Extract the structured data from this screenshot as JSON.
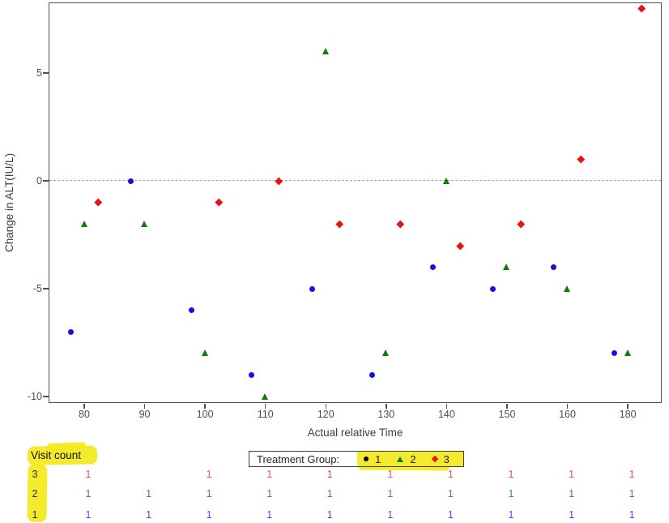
{
  "chart_data": {
    "type": "scatter",
    "title": "",
    "xlabel": "Actual relative Time",
    "ylabel": "Change in ALT(IU/L)",
    "categories": [
      80,
      90,
      100,
      110,
      120,
      130,
      140,
      150,
      160,
      180
    ],
    "x_ticks": [
      "80",
      "90",
      "100",
      "110",
      "120",
      "130",
      "140",
      "150",
      "160",
      "180"
    ],
    "y_ticks": [
      5,
      0,
      -5,
      -10
    ],
    "ylim": [
      -10.3,
      8.3
    ],
    "reference_line_y": 0,
    "grid": false,
    "legend_position": "bottom",
    "series": [
      {
        "name": "1",
        "marker": "circle",
        "color": "#1212df",
        "values": [
          -7,
          0,
          -6,
          -9,
          -5,
          -9,
          -4,
          -5,
          -4,
          -8
        ]
      },
      {
        "name": "2",
        "marker": "triangle",
        "color": "#0a7d0a",
        "values": [
          -2,
          -2,
          -8,
          -10,
          6,
          -8,
          0,
          -4,
          -5,
          -8
        ]
      },
      {
        "name": "3",
        "marker": "diamond",
        "color": "#e81212",
        "values": [
          -1,
          null,
          -1,
          0,
          -2,
          -2,
          -3,
          -2,
          1,
          8
        ]
      }
    ]
  },
  "legend": {
    "title": "Treatment Group:",
    "entries": [
      {
        "label": "1",
        "marker": "circle",
        "color": "#000000"
      },
      {
        "label": "2",
        "marker": "triangle",
        "color": "#0a7d0a"
      },
      {
        "label": "3",
        "marker": "diamond",
        "color": "#e81212"
      }
    ]
  },
  "visit_table": {
    "title": "Visit count",
    "rows": [
      {
        "label": "3",
        "color": "#f05252",
        "values": [
          1,
          null,
          1,
          1,
          1,
          1,
          1,
          1,
          1,
          1
        ]
      },
      {
        "label": "2",
        "color": "#2f9e2f",
        "values": [
          1,
          1,
          1,
          1,
          1,
          1,
          1,
          1,
          1,
          1
        ]
      },
      {
        "label": "1",
        "color": "#4848ee",
        "values": [
          1,
          1,
          1,
          1,
          1,
          1,
          1,
          1,
          1,
          1
        ]
      }
    ]
  },
  "colors": {
    "highlight": "#f3e91d",
    "axis": "#4f4f4f",
    "reference_line": "#a3a3a3"
  }
}
